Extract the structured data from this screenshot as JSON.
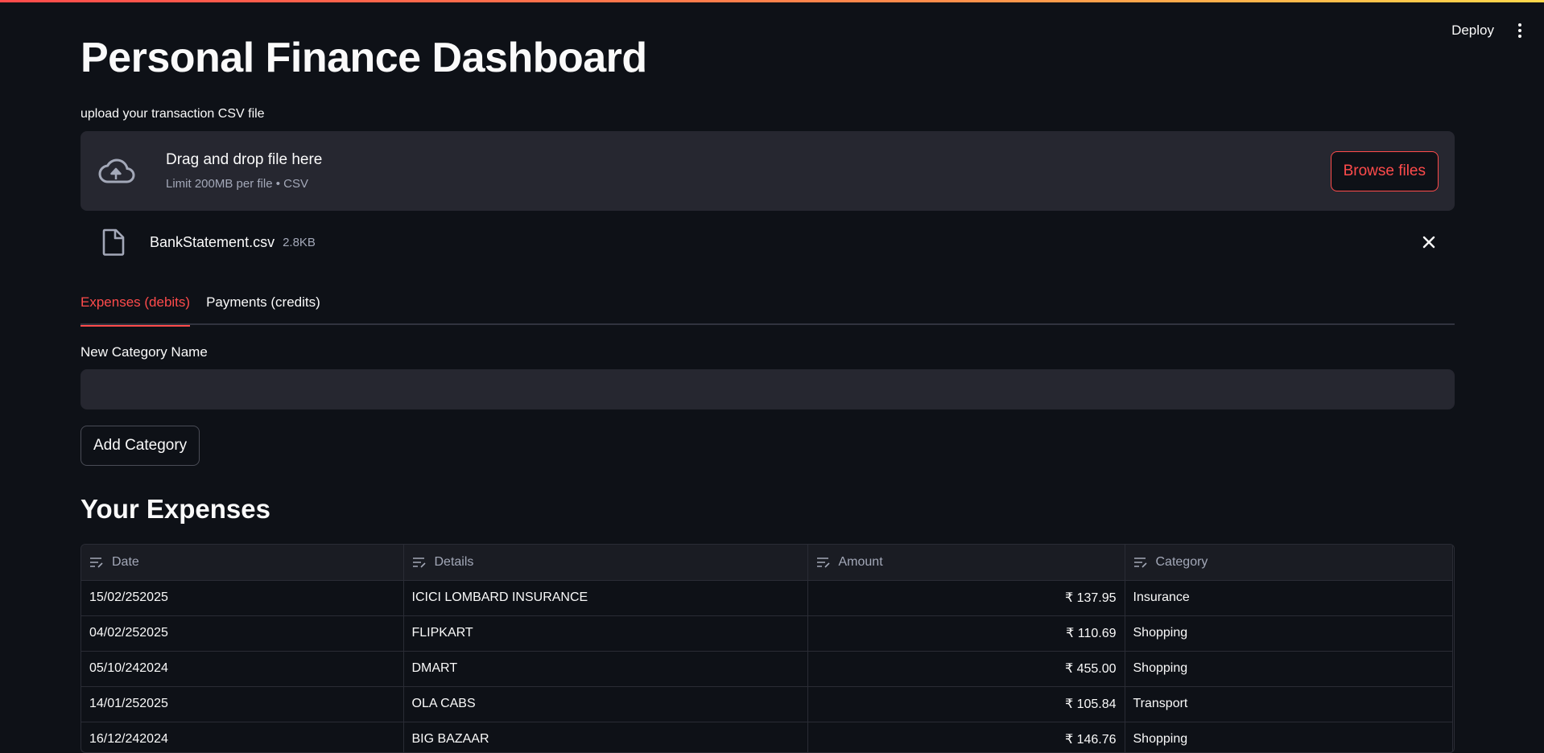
{
  "header": {
    "deploy_label": "Deploy"
  },
  "page": {
    "title": "Personal Finance Dashboard"
  },
  "uploader": {
    "label": "upload your transaction CSV file",
    "drop_title": "Drag and drop file here",
    "drop_subtitle": "Limit 200MB per file • CSV",
    "browse_label": "Browse files",
    "file": {
      "name": "BankStatement.csv",
      "size": "2.8KB"
    }
  },
  "tabs": [
    {
      "label": "Expenses (debits)",
      "active": true
    },
    {
      "label": "Payments (credits)",
      "active": false
    }
  ],
  "category_form": {
    "label": "New Category Name",
    "value": "",
    "add_label": "Add Category"
  },
  "expenses": {
    "title": "Your Expenses",
    "columns": [
      "Date",
      "Details",
      "Amount",
      "Category"
    ],
    "rows": [
      {
        "date": "15/02/252025",
        "details": "ICICI LOMBARD INSURANCE",
        "amount": "₹ 137.95",
        "category": "Insurance"
      },
      {
        "date": "04/02/252025",
        "details": "FLIPKART",
        "amount": "₹ 110.69",
        "category": "Shopping"
      },
      {
        "date": "05/10/242024",
        "details": "DMART",
        "amount": "₹ 455.00",
        "category": "Shopping"
      },
      {
        "date": "14/01/252025",
        "details": "OLA CABS",
        "amount": "₹ 105.84",
        "category": "Transport"
      },
      {
        "date": "16/12/242024",
        "details": "BIG BAZAAR",
        "amount": "₹ 146.76",
        "category": "Shopping"
      }
    ]
  },
  "colors": {
    "accent": "#ff4b4b",
    "background": "#0e1117",
    "surface": "#262730"
  }
}
